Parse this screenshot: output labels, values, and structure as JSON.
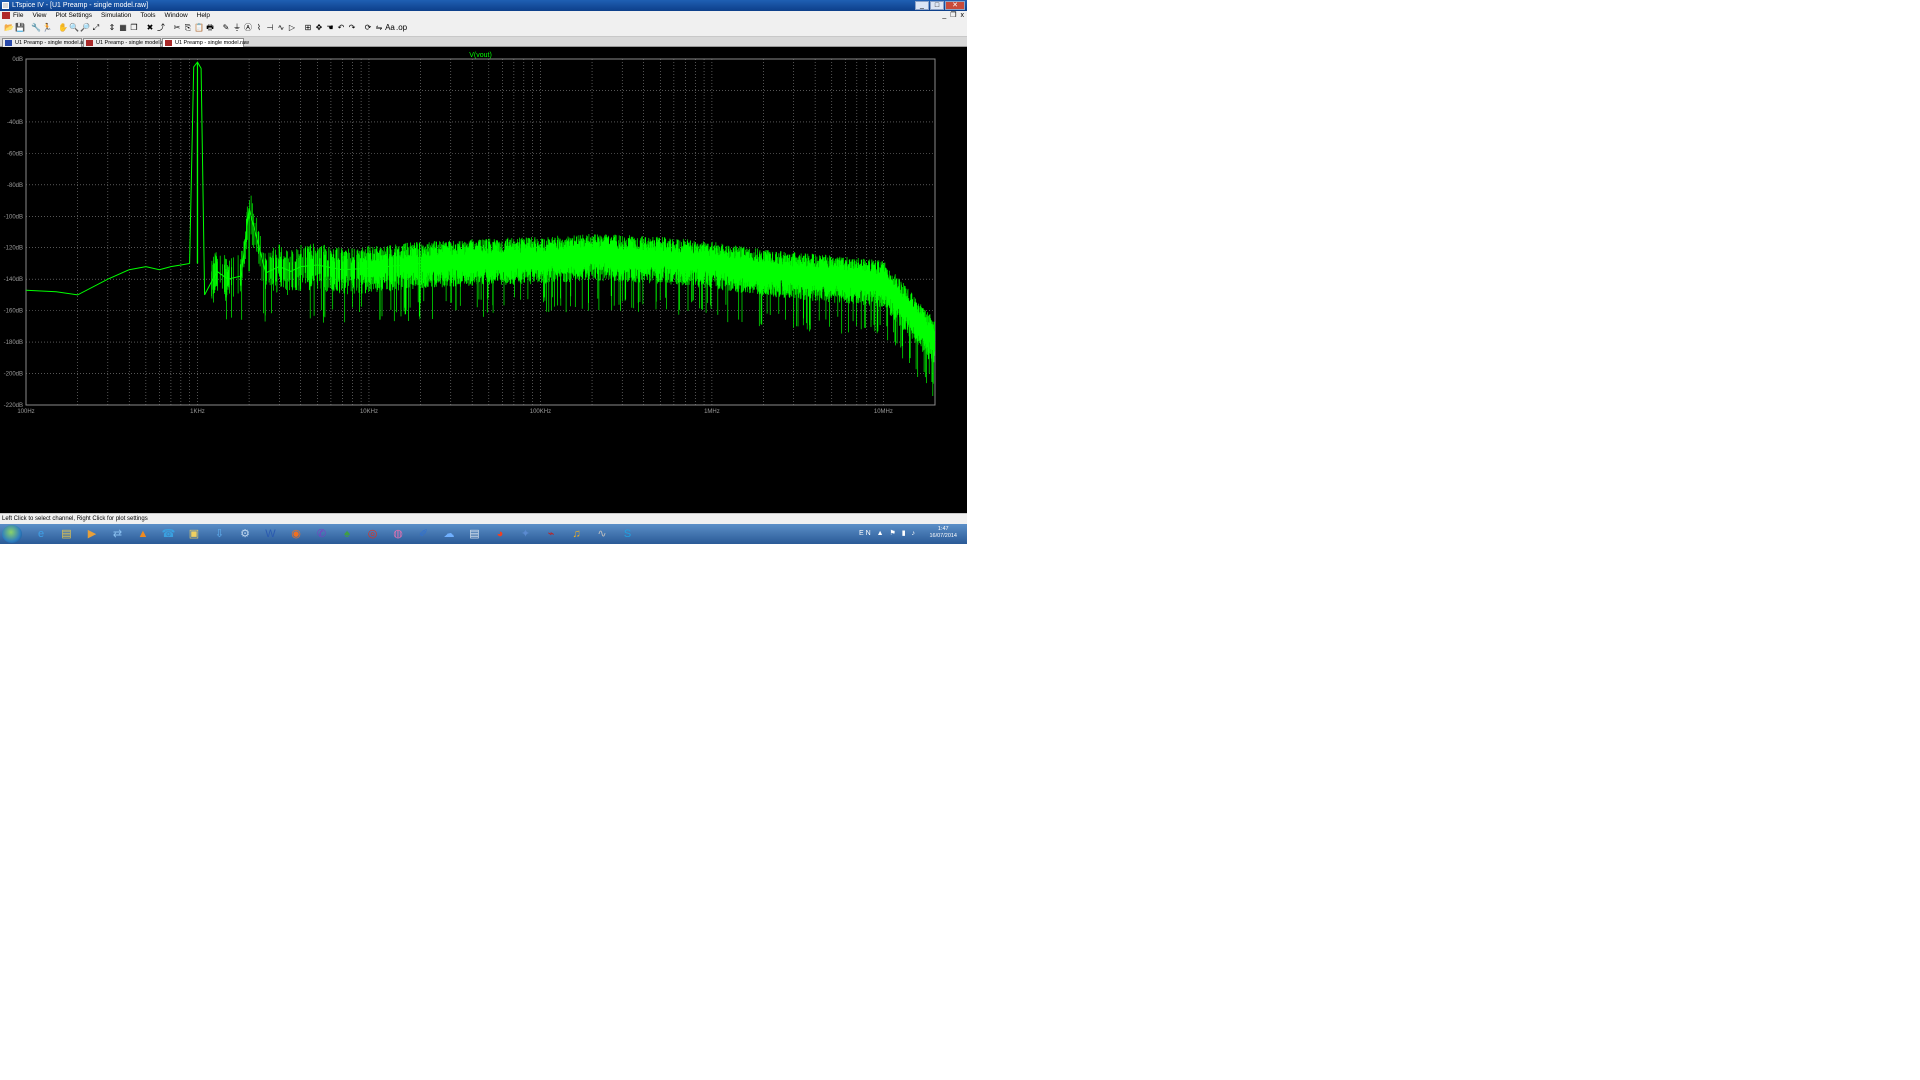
{
  "window": {
    "title": "LTspice IV - [U1 Preamp - single model.raw]",
    "minimize": "_",
    "maximize": "□",
    "close": "✕"
  },
  "menu": {
    "items": [
      "File",
      "View",
      "Plot Settings",
      "Simulation",
      "Tools",
      "Window",
      "Help"
    ],
    "mdi_minimize": "_",
    "mdi_restore": "❐",
    "mdi_close": "x"
  },
  "toolbar": {
    "buttons": [
      {
        "icon": "open-icon",
        "glyph": "📂"
      },
      {
        "icon": "save-icon",
        "glyph": "💾"
      },
      {
        "icon": "control-panel-icon",
        "glyph": "🔧"
      },
      {
        "icon": "run-icon",
        "glyph": "🏃"
      },
      {
        "icon": "halt-icon",
        "glyph": "✋"
      },
      {
        "icon": "zoom-in-icon",
        "glyph": "🔍"
      },
      {
        "icon": "zoom-out-icon",
        "glyph": "🔎"
      },
      {
        "icon": "zoom-fit-icon",
        "glyph": "⤢"
      },
      {
        "icon": "autorange-icon",
        "glyph": "⇕"
      },
      {
        "icon": "tile-icon",
        "glyph": "▦"
      },
      {
        "icon": "cascade-icon",
        "glyph": "❐"
      },
      {
        "icon": "close-plot-icon",
        "glyph": "✖"
      },
      {
        "icon": "pick-trace-icon",
        "glyph": "⤴"
      },
      {
        "icon": "cut-icon",
        "glyph": "✂"
      },
      {
        "icon": "copy-icon",
        "glyph": "⎘"
      },
      {
        "icon": "paste-icon",
        "glyph": "📋"
      },
      {
        "icon": "print-icon",
        "glyph": "🖶"
      },
      {
        "icon": "wire-icon",
        "glyph": "✎"
      },
      {
        "icon": "ground-icon",
        "glyph": "⏚"
      },
      {
        "icon": "label-icon",
        "glyph": "Ⓐ"
      },
      {
        "icon": "resistor-icon",
        "glyph": "⌇"
      },
      {
        "icon": "capacitor-icon",
        "glyph": "⊣"
      },
      {
        "icon": "inductor-icon",
        "glyph": "∿"
      },
      {
        "icon": "diode-icon",
        "glyph": "▷"
      },
      {
        "icon": "component-icon",
        "glyph": "⊞"
      },
      {
        "icon": "move-icon",
        "glyph": "✥"
      },
      {
        "icon": "drag-icon",
        "glyph": "☚"
      },
      {
        "icon": "undo-icon",
        "glyph": "↶"
      },
      {
        "icon": "redo-icon",
        "glyph": "↷"
      },
      {
        "icon": "rotate-icon",
        "glyph": "⟳"
      },
      {
        "icon": "mirror-icon",
        "glyph": "⇋"
      },
      {
        "icon": "text-icon",
        "glyph": "Aa"
      },
      {
        "icon": "spice-directive-icon",
        "glyph": ".op"
      }
    ]
  },
  "tabs": [
    {
      "label": "U1 Preamp - single model.asc",
      "active": false
    },
    {
      "label": "U1 Preamp - single model.raw",
      "active": false
    },
    {
      "label": "U1 Preamp - single model.raw",
      "active": true
    }
  ],
  "plot": {
    "trace_label": "V(vout)",
    "trace_color": "#00ff00",
    "grid_color": "#8a8a8a",
    "axis_label_color": "#9a9a9a",
    "background": "#000000"
  },
  "chart_data": {
    "type": "line",
    "title": "",
    "xlabel": "",
    "ylabel": "",
    "x_scale": "log",
    "xlim": [
      100,
      20000000
    ],
    "ylim": [
      -220,
      0
    ],
    "grid": true,
    "legend": "V(vout)",
    "x_ticks": [
      {
        "value": 100,
        "label": "100Hz"
      },
      {
        "value": 1000,
        "label": "1KHz"
      },
      {
        "value": 10000,
        "label": "10KHz"
      },
      {
        "value": 100000,
        "label": "100KHz"
      },
      {
        "value": 1000000,
        "label": "1MHz"
      },
      {
        "value": 10000000,
        "label": "10MHz"
      }
    ],
    "y_ticks": [
      {
        "value": 0,
        "label": "0dB"
      },
      {
        "value": -20,
        "label": "-20dB"
      },
      {
        "value": -40,
        "label": "-40dB"
      },
      {
        "value": -60,
        "label": "-60dB"
      },
      {
        "value": -80,
        "label": "-80dB"
      },
      {
        "value": -100,
        "label": "-100dB"
      },
      {
        "value": -120,
        "label": "-120dB"
      },
      {
        "value": -140,
        "label": "-140dB"
      },
      {
        "value": -160,
        "label": "-160dB"
      },
      {
        "value": -180,
        "label": "-180dB"
      },
      {
        "value": -200,
        "label": "-200dB"
      },
      {
        "value": -220,
        "label": "-220dB"
      }
    ],
    "series": [
      {
        "name": "V(vout)",
        "color": "#00ff00",
        "x": [
          100,
          150,
          200,
          300,
          400,
          500,
          600,
          700,
          800,
          900,
          950,
          1000,
          1050,
          1100,
          1300,
          1500,
          1800,
          2000,
          2500,
          3000,
          3500,
          4000,
          5000,
          7000,
          10000,
          20000,
          50000,
          100000,
          200000,
          500000,
          1000000,
          2000000,
          4000000,
          7000000,
          10000000,
          14000000,
          20000000
        ],
        "y": [
          -147,
          -148,
          -150,
          -140,
          -134,
          -132,
          -134,
          -132,
          -131,
          -130,
          -5,
          -2,
          -6,
          -150,
          -135,
          -140,
          -138,
          -95,
          -136,
          -132,
          -135,
          -132,
          -131,
          -134,
          -133,
          -130,
          -128,
          -127,
          -125,
          -127,
          -130,
          -135,
          -138,
          -140,
          -142,
          -160,
          -180
        ]
      }
    ]
  },
  "status": {
    "text": "Left Click to select channel, Right Click for plot settings"
  },
  "taskbar": {
    "icons": [
      "ie-icon",
      "explorer-icon",
      "media-icon",
      "network-icon",
      "vlc-icon",
      "skype-old-icon",
      "folder-icon",
      "downloads-icon",
      "settings-icon",
      "word-icon",
      "firefox-icon",
      "viber-icon",
      "game-icon",
      "media-player-icon",
      "disc-icon",
      "paint-icon",
      "cloud-icon",
      "notepad-icon",
      "chrome-icon",
      "cad-icon",
      "ltspice-icon",
      "audio-icon",
      "scope-icon",
      "skype-icon"
    ],
    "clock_time": "1:47",
    "clock_date": "16/07/2014",
    "tray": "EN ▲ ⚑ ▮ ♪"
  }
}
